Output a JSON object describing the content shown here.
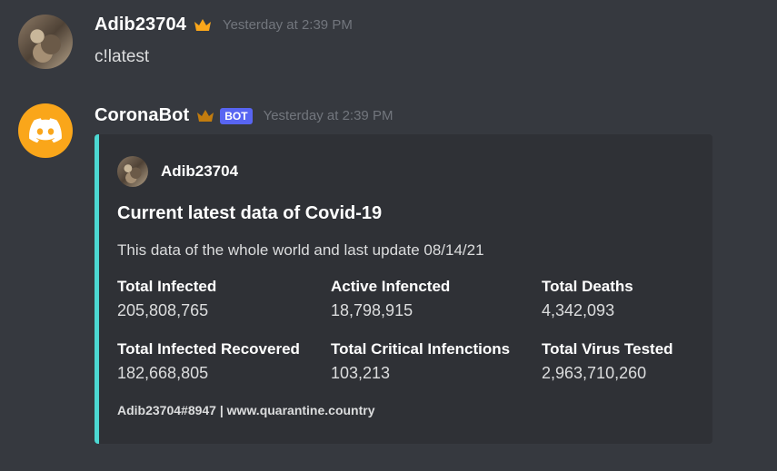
{
  "messages": [
    {
      "username": "Adib23704",
      "timestamp": "Yesterday at 2:39 PM",
      "text": "c!latest",
      "crown_color": "#faa61a"
    },
    {
      "username": "CoronaBot",
      "bot_tag": "BOT",
      "timestamp": "Yesterday at 2:39 PM",
      "crown_color": "#c27c0e",
      "embed": {
        "accent_color": "#4cd8d2",
        "author": "Adib23704",
        "title": "Current latest data of Covid-19",
        "description": "This data of the whole world and last update 08/14/21",
        "fields": [
          {
            "name": "Total Infected",
            "value": "205,808,765"
          },
          {
            "name": "Active Infencted",
            "value": "18,798,915"
          },
          {
            "name": "Total Deaths",
            "value": "4,342,093"
          },
          {
            "name": "Total Infected Recovered",
            "value": "182,668,805"
          },
          {
            "name": "Total Critical Infenctions",
            "value": "103,213"
          },
          {
            "name": "Total Virus Tested",
            "value": "2,963,710,260"
          }
        ],
        "footer": "Adib23704#8947 | www.quarantine.country"
      }
    }
  ]
}
